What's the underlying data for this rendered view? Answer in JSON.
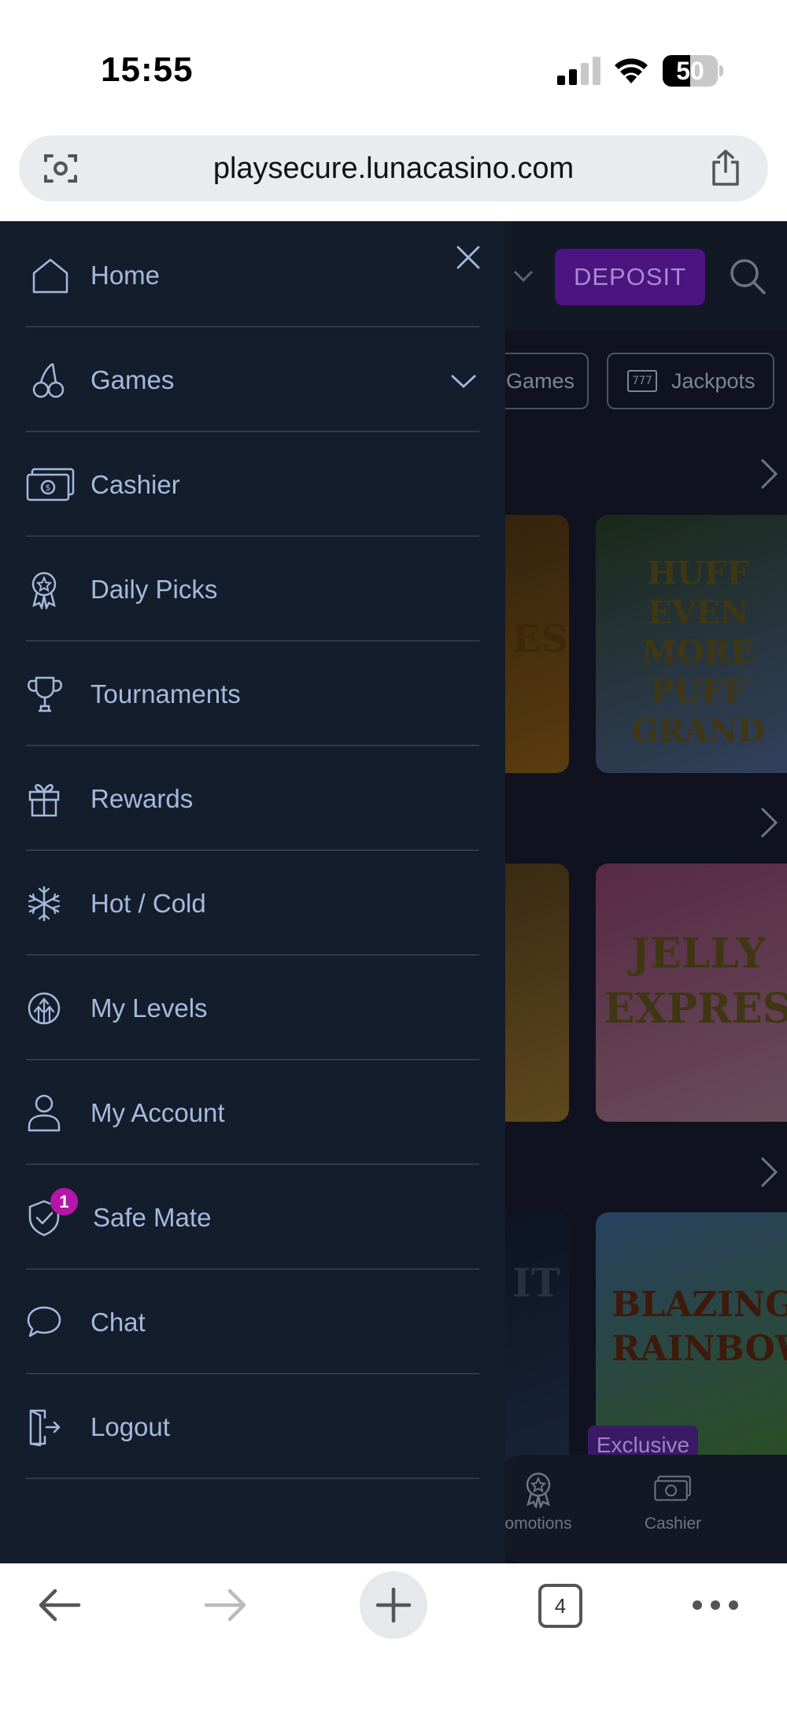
{
  "status_bar": {
    "time": "15:55",
    "battery_level": "50",
    "battery_fraction": 0.5
  },
  "browser": {
    "url": "playsecure.lunacasino.com",
    "tab_count": "4"
  },
  "page": {
    "deposit_label": "DEPOSIT",
    "chips": [
      {
        "label": "Games"
      },
      {
        "label": "Jackpots"
      }
    ],
    "jackpot_chip_icon_text": "777",
    "tiles": [
      {
        "title": "ES",
        "colors": [
          "#6e4a1e",
          "#c9871f"
        ]
      },
      {
        "title": "HUFF EVEN MORE PUFF GRAND",
        "colors": [
          "#3a5a3a",
          "#6f8fd0"
        ]
      },
      {
        "title": "",
        "colors": [
          "#7a5a2a",
          "#d3a040"
        ]
      },
      {
        "title": "JELLY EXPRESS",
        "colors": [
          "#c25c9a",
          "#e9a9c8"
        ]
      },
      {
        "title": "IT",
        "colors": [
          "#1c2a4a",
          "#35507a"
        ]
      },
      {
        "title": "BLAZING RAINBOW",
        "colors": [
          "#5a8fd6",
          "#5fb04a"
        ]
      }
    ],
    "exclusive_label": "Exclusive",
    "bottom_nav": [
      {
        "label": "omotions",
        "icon": "medal-icon"
      },
      {
        "label": "Cashier",
        "icon": "cash-icon"
      }
    ]
  },
  "menu": {
    "items": [
      {
        "label": "Home",
        "icon": "home-icon"
      },
      {
        "label": "Games",
        "icon": "cherries-icon",
        "expandable": true
      },
      {
        "label": "Cashier",
        "icon": "cash-icon"
      },
      {
        "label": "Daily Picks",
        "icon": "medal-star-icon"
      },
      {
        "label": "Tournaments",
        "icon": "trophy-icon"
      },
      {
        "label": "Rewards",
        "icon": "gift-icon"
      },
      {
        "label": "Hot / Cold",
        "icon": "snowflake-icon"
      },
      {
        "label": "My Levels",
        "icon": "levels-icon"
      },
      {
        "label": "My Account",
        "icon": "person-icon"
      },
      {
        "label": "Safe Mate",
        "icon": "shield-check-icon",
        "badge": "1"
      },
      {
        "label": "Chat",
        "icon": "chat-bubble-icon"
      },
      {
        "label": "Logout",
        "icon": "logout-icon"
      }
    ]
  },
  "colors": {
    "drawer_bg": "#141d2b",
    "menu_text": "#a6b9dc",
    "divider": "#2c3a4c",
    "badge": "#b316a8",
    "deposit_bg": "#4b1480"
  }
}
